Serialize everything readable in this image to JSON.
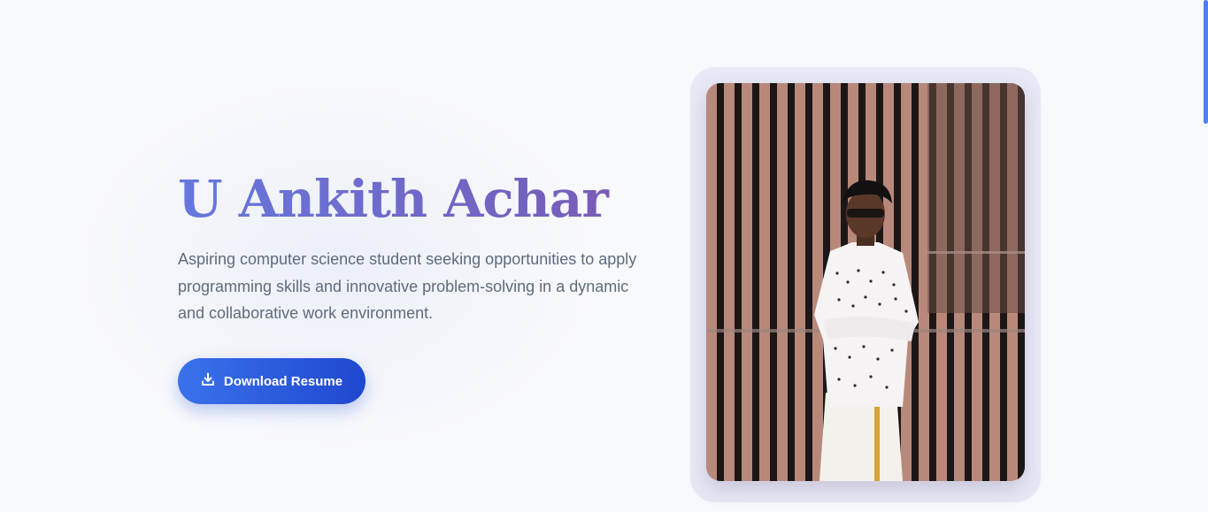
{
  "hero": {
    "name": "U Ankith Achar",
    "description": "Aspiring computer science student seeking opportunities to apply programming skills and innovative problem-solving in a dynamic and collaborative work environment.",
    "download_button": {
      "label": "Download Resume",
      "icon": "download-icon"
    }
  },
  "profile_photo": {
    "alt": "Profile photo"
  },
  "colors": {
    "name_gradient_start": "#6678dd",
    "name_gradient_end": "#7a59b4",
    "button_gradient_start": "#3a72ea",
    "button_gradient_end": "#1f47cf",
    "scroll_indicator": "#4f7ef0"
  }
}
